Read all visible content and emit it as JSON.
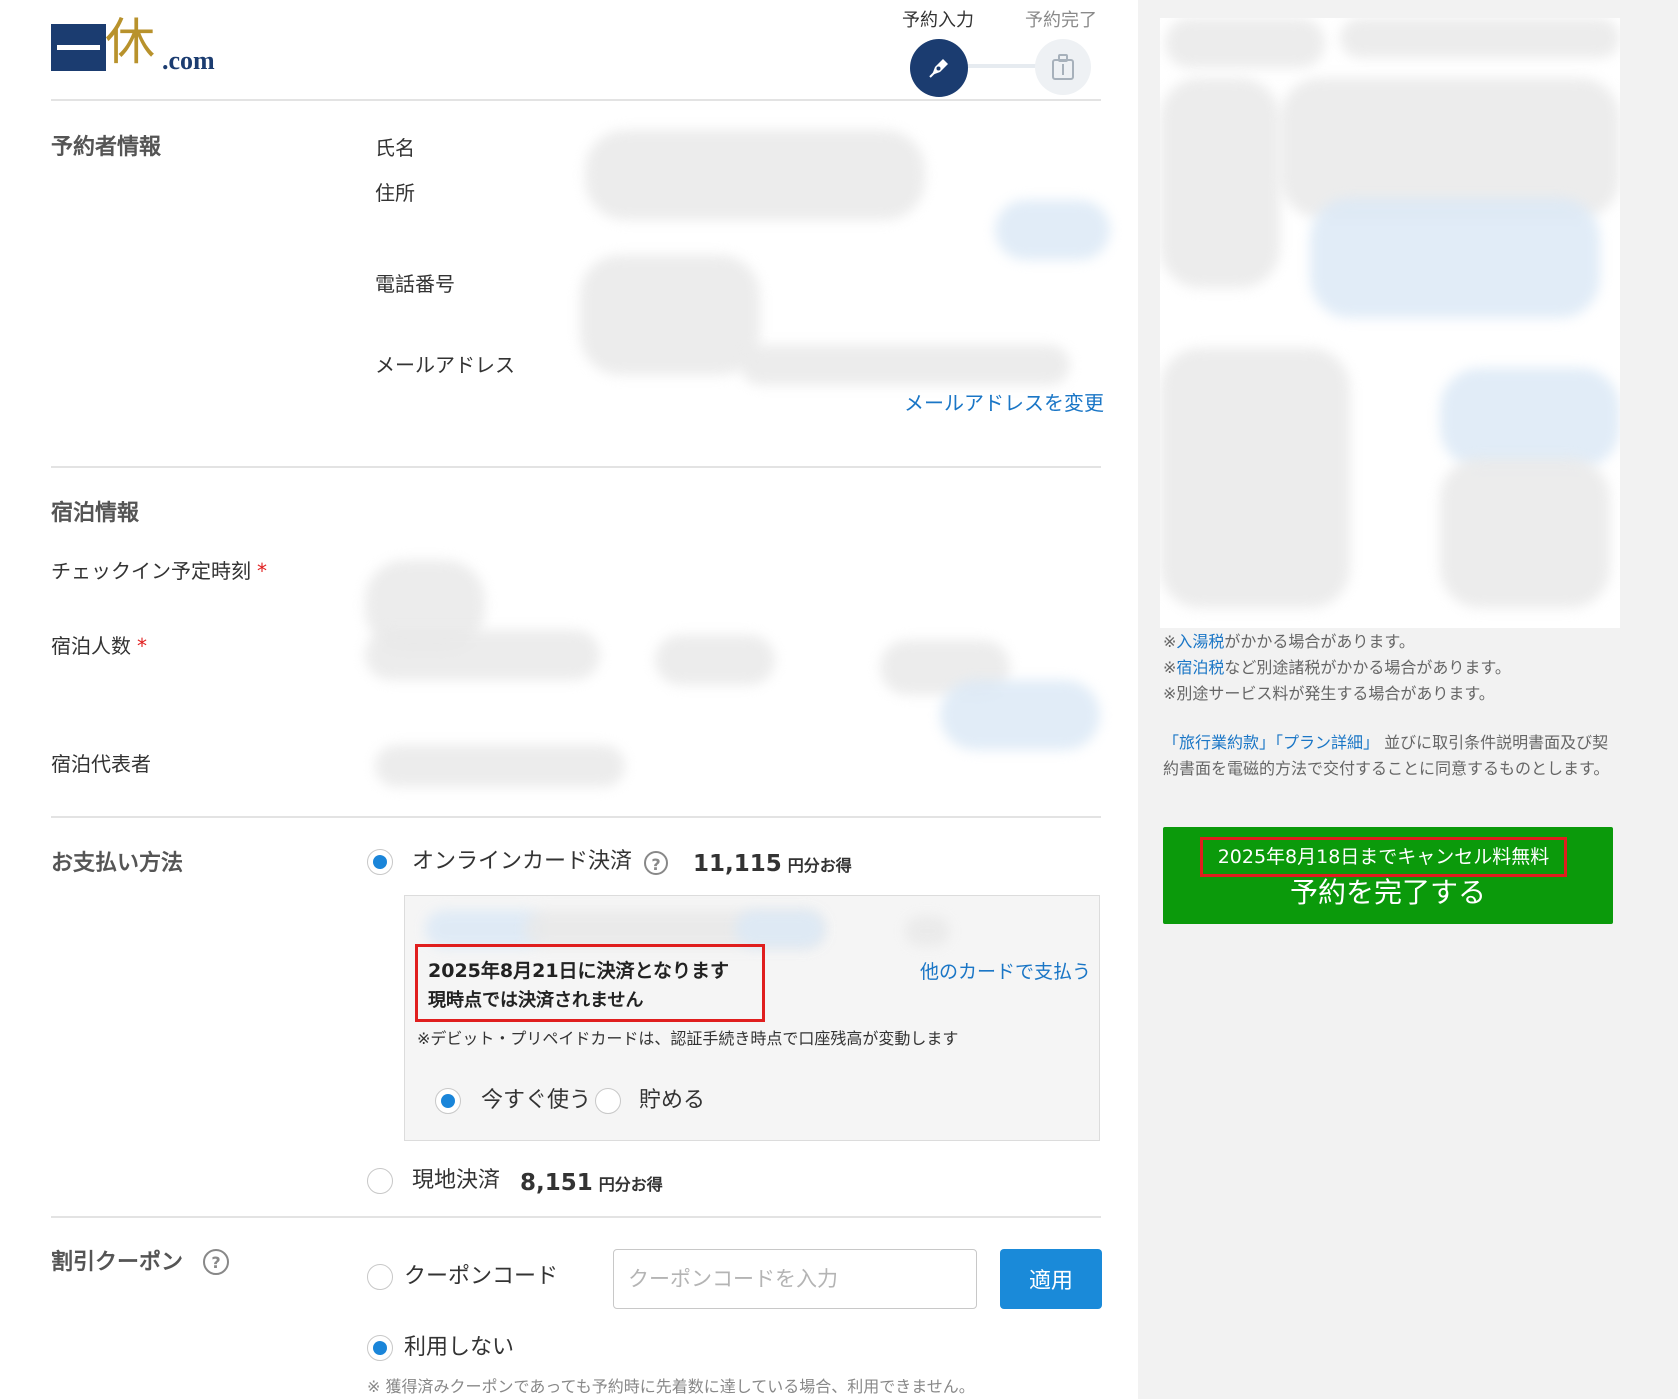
{
  "header": {
    "logo_kanji": "休",
    "logo_suffix": ".com",
    "steps": [
      {
        "label": "予約入力",
        "active": true,
        "icon": "pen-icon"
      },
      {
        "label": "予約完了",
        "active": false,
        "icon": "luggage-icon"
      }
    ]
  },
  "booker": {
    "title": "予約者情報",
    "name_label": "氏名",
    "address_label": "住所",
    "phone_label": "電話番号",
    "email_label": "メールアドレス",
    "change_email_link": "メールアドレスを変更"
  },
  "stay": {
    "title": "宿泊情報",
    "checkin_label": "チェックイン予定時刻",
    "guests_label": "宿泊人数",
    "representative_label": "宿泊代表者",
    "required_mark": "*"
  },
  "payment": {
    "title": "お支払い方法",
    "options": [
      {
        "label": "オンラインカード決済",
        "amount": "11,115",
        "unit": "円分お得",
        "selected": true,
        "help_icon": "question-circle-icon"
      },
      {
        "label": "現地決済",
        "amount": "8,151",
        "unit": "円分お得",
        "selected": false
      }
    ],
    "card": {
      "settle_date_line": "2025年8月21日に決済となります",
      "not_settled_line": "現時点では決済されません",
      "other_card_link": "他のカードで支払う",
      "debit_note": "※デビット・プリペイドカードは、認証手続き時点で口座残高が変動します",
      "points_options": [
        {
          "label": "今すぐ使う",
          "selected": true
        },
        {
          "label": "貯める",
          "selected": false
        }
      ]
    }
  },
  "coupon": {
    "title": "割引クーポン",
    "code_option": "クーポンコード",
    "input_placeholder": "クーポンコードを入力",
    "apply_button": "適用",
    "no_use_option": "利用しない",
    "note": "※ 獲得済みクーポンであっても予約時に先着数に達している場合、利用できません。"
  },
  "sidebar": {
    "tax_notes": [
      {
        "prefix": "※",
        "link": "入湯税",
        "text": "がかかる場合があります。"
      },
      {
        "prefix": "※",
        "link": "宿泊税",
        "text": "など別途諸税がかかる場合があります。"
      },
      {
        "prefix": "※",
        "link": "",
        "text": "別途サービス料が発生する場合があります。"
      }
    ],
    "consent": {
      "link1": "「旅行業約款」",
      "link2": "「プラン詳細」",
      "text": "並びに取引条件説明書面及び契約書面を電磁的方法で交付することに同意するものとします。"
    },
    "cancel_free_text": "2025年8月18日までキャンセル料無料",
    "complete_button": "予約を完了する"
  },
  "colors": {
    "brand_navy": "#1b3c70",
    "brand_gold": "#b8922c",
    "link_blue": "#1a76c6",
    "radio_blue": "#1a85d9",
    "apply_blue": "#1a8ad9",
    "complete_green": "#0b9a0b",
    "highlight_red": "#e01e1e"
  }
}
